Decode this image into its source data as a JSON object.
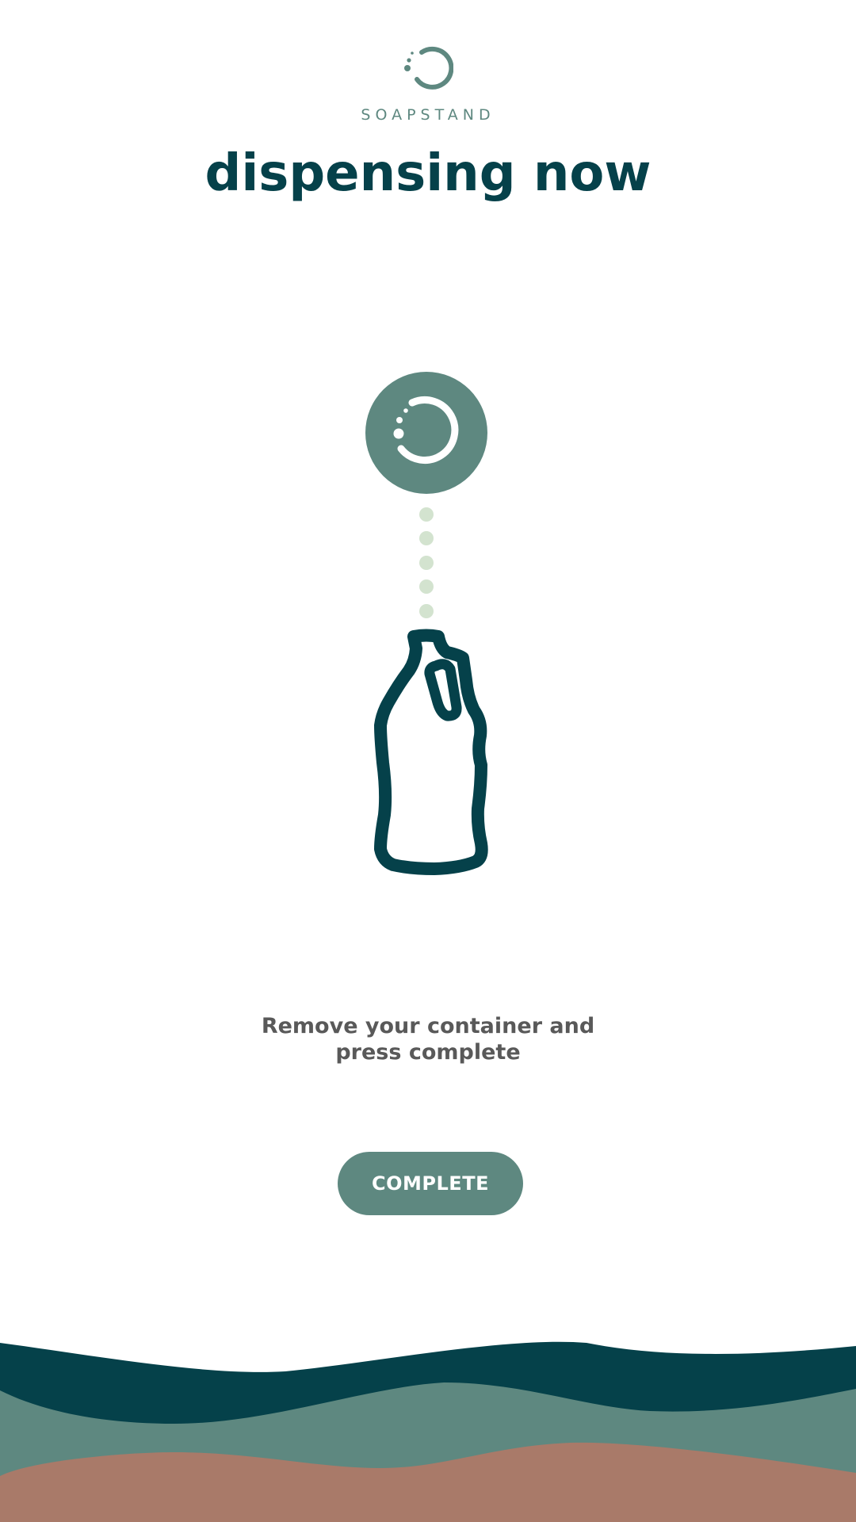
{
  "brand": {
    "name": "SOAPSTAND",
    "logo_icon": "soapstand-bubble-ring-icon"
  },
  "title": "dispensing now",
  "illustration": {
    "dispenser_icon": "soapstand-bubble-ring-icon",
    "drop_icon": "soap-drop-dots",
    "container_icon": "bottle-icon"
  },
  "instruction": {
    "line1": "Remove your container and",
    "line2": "press complete"
  },
  "actions": {
    "complete_label": "COMPLETE"
  },
  "colors": {
    "primary_dark": "#05414a",
    "primary": "#5e8880",
    "drop": "#d3e3cf",
    "accent_clay": "#a97a69",
    "text_gray": "#595959"
  }
}
